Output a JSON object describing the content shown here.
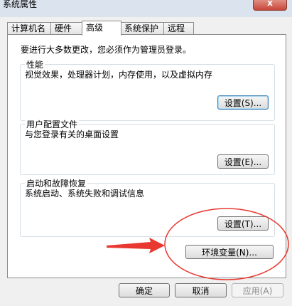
{
  "window": {
    "title": "系统属性",
    "close_glyph": "x"
  },
  "tabs": [
    {
      "label": "计算机名"
    },
    {
      "label": "硬件"
    },
    {
      "label": "高级",
      "active": true
    },
    {
      "label": "系统保护"
    },
    {
      "label": "远程"
    }
  ],
  "note": "要进行大多数更改，您必须作为管理员登录。",
  "groups": {
    "performance": {
      "title": "性能",
      "desc": "视觉效果，处理器计划，内存使用，以及虚拟内存",
      "button": "设置(S)..."
    },
    "profiles": {
      "title": "用户配置文件",
      "desc": "与您登录有关的桌面设置",
      "button": "设置(E)..."
    },
    "startup": {
      "title": "启动和故障恢复",
      "desc": "系统启动、系统失败和调试信息",
      "button": "设置(T)..."
    }
  },
  "env_button": "环境变量(N)...",
  "footer": {
    "ok": "确定",
    "cancel": "取消",
    "apply": "应用(A)"
  },
  "annotation": {
    "color": "#e8382f"
  }
}
